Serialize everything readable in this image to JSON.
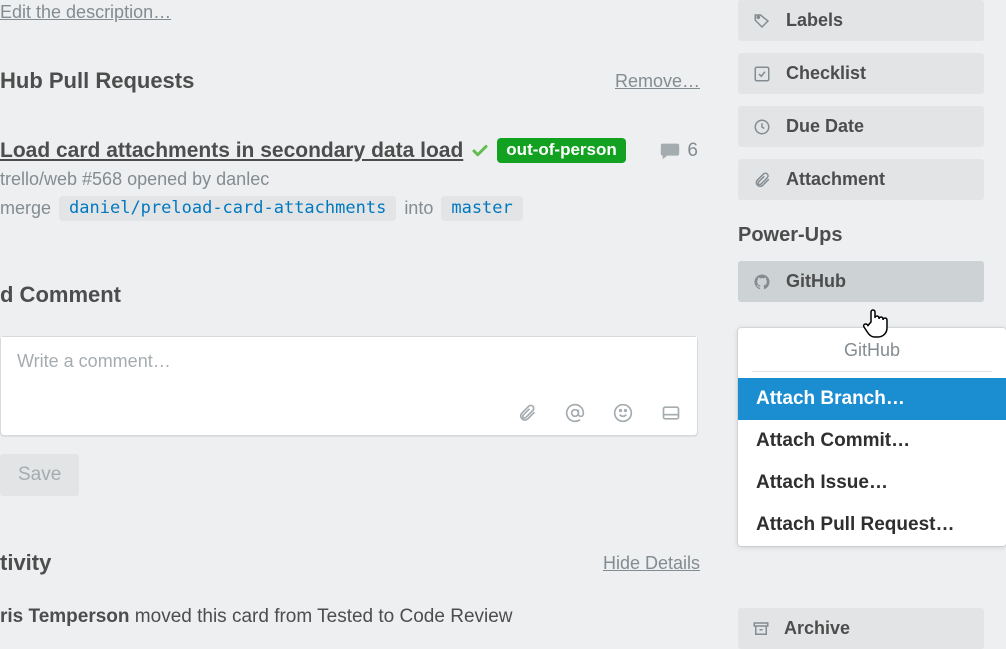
{
  "description": {
    "edit_link": "Edit the description…"
  },
  "pull_requests": {
    "title": "Hub Pull Requests",
    "remove_link": "Remove…",
    "items": [
      {
        "title": "Load card attachments in secondary data load",
        "status_badge": "out-of-person",
        "comments": "6",
        "repo_line": "trello/web #568 opened by danlec",
        "merge_prefix": "merge",
        "branch_from": "daniel/preload-card-attachments",
        "merge_into": "into",
        "branch_to": "master"
      }
    ]
  },
  "comment": {
    "title": "d Comment",
    "placeholder": "Write a comment…",
    "save_label": "Save"
  },
  "activity": {
    "title": "tivity",
    "hide_link": "Hide Details",
    "entries": [
      {
        "user": "ris Temperson",
        "rest": " moved this card from Tested to Code Review"
      }
    ]
  },
  "sidebar": {
    "buttons": {
      "labels": "Labels",
      "checklist": "Checklist",
      "due_date": "Due Date",
      "attachment": "Attachment"
    },
    "powerups_title": "Power-Ups",
    "github": "GitHub",
    "archive": "Archive"
  },
  "github_popover": {
    "title": "GitHub",
    "items": [
      "Attach Branch…",
      "Attach Commit…",
      "Attach Issue…",
      "Attach Pull Request…"
    ],
    "active_index": 0
  }
}
